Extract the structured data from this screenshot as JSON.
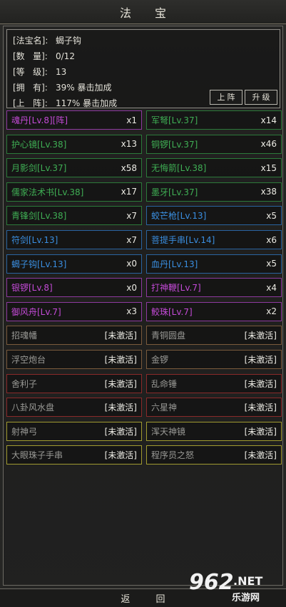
{
  "title": "法 宝",
  "info": {
    "rows": [
      {
        "key": "[法宝名]:",
        "value": "蝎子钩"
      },
      {
        "key": "[数   量]:",
        "value": "0/12"
      },
      {
        "key": "[等   级]:",
        "value": "13"
      },
      {
        "key": "[拥   有]:",
        "value": "39% 暴击加成"
      },
      {
        "key": "[上   阵]:",
        "value": "117% 暴击加成"
      }
    ],
    "btn_equip": "上阵",
    "btn_upgrade": "升级"
  },
  "items": [
    {
      "name": "魂丹[Lv.8][阵]",
      "count": "x1",
      "color": "#c34ad6",
      "border": "#8e3aa0"
    },
    {
      "name": "军弩[Lv.37]",
      "count": "x14",
      "color": "#3fae54",
      "border": "#2c7a3a"
    },
    {
      "name": "护心镜[Lv.38]",
      "count": "x13",
      "color": "#3fae54",
      "border": "#2c7a3a"
    },
    {
      "name": "铜锣[Lv.37]",
      "count": "x46",
      "color": "#3fae54",
      "border": "#2c7a3a"
    },
    {
      "name": "月影剑[Lv.37]",
      "count": "x58",
      "color": "#3fae54",
      "border": "#2c7a3a"
    },
    {
      "name": "无悔箭[Lv.38]",
      "count": "x15",
      "color": "#3fae54",
      "border": "#2c7a3a"
    },
    {
      "name": "儒家法术书[Lv.38]",
      "count": "x17",
      "color": "#3fae54",
      "border": "#2c7a3a"
    },
    {
      "name": "墨牙[Lv.37]",
      "count": "x38",
      "color": "#3fae54",
      "border": "#2c7a3a"
    },
    {
      "name": "青锋剑[Lv.38]",
      "count": "x7",
      "color": "#3fae54",
      "border": "#2c7a3a"
    },
    {
      "name": "蛟芒枪[Lv.13]",
      "count": "x5",
      "color": "#3a8ee0",
      "border": "#2a64a0"
    },
    {
      "name": "符剑[Lv.13]",
      "count": "x7",
      "color": "#3a8ee0",
      "border": "#2a64a0"
    },
    {
      "name": "菩提手串[Lv.14]",
      "count": "x6",
      "color": "#3a8ee0",
      "border": "#2a64a0"
    },
    {
      "name": "蝎子钩[Lv.13]",
      "count": "x0",
      "color": "#3a8ee0",
      "border": "#2a64a0"
    },
    {
      "name": "血丹[Lv.13]",
      "count": "x5",
      "color": "#3a8ee0",
      "border": "#2a64a0"
    },
    {
      "name": "银锣[Lv.8]",
      "count": "x0",
      "color": "#c34ad6",
      "border": "#8e3aa0"
    },
    {
      "name": "打神鞭[Lv.7]",
      "count": "x4",
      "color": "#c34ad6",
      "border": "#8e3aa0"
    },
    {
      "name": "御风舟[Lv.7]",
      "count": "x3",
      "color": "#c34ad6",
      "border": "#8e3aa0"
    },
    {
      "name": "鲛珠[Lv.7]",
      "count": "x2",
      "color": "#c34ad6",
      "border": "#8e3aa0"
    },
    {
      "name": "招魂幡",
      "count": "[未激活]",
      "color": "#9a9a96",
      "border": "#7a5a3c"
    },
    {
      "name": "青铜圆盘",
      "count": "[未激活]",
      "color": "#9a9a96",
      "border": "#7a5a3c"
    },
    {
      "name": "浮空炮台",
      "count": "[未激活]",
      "color": "#9a9a96",
      "border": "#7a5a3c"
    },
    {
      "name": "金锣",
      "count": "[未激活]",
      "color": "#9a9a96",
      "border": "#7a5a3c"
    },
    {
      "name": "舍利子",
      "count": "[未激活]",
      "color": "#9a9a96",
      "border": "#8a2a2a"
    },
    {
      "name": "乱命锤",
      "count": "[未激活]",
      "color": "#9a9a96",
      "border": "#8a2a2a"
    },
    {
      "name": "八卦风水盘",
      "count": "[未激活]",
      "color": "#9a9a96",
      "border": "#8a2a2a"
    },
    {
      "name": "六星神",
      "count": "[未激活]",
      "color": "#9a9a96",
      "border": "#8a2a2a"
    },
    {
      "name": "射神弓",
      "count": "[未激活]",
      "color": "#9a9a96",
      "border": "#a09a30"
    },
    {
      "name": "浑天神镜",
      "count": "[未激活]",
      "color": "#9a9a96",
      "border": "#a09a30"
    },
    {
      "name": "大眼珠子手串",
      "count": "[未激活]",
      "color": "#9a9a96",
      "border": "#a09a30"
    },
    {
      "name": "程序员之怒",
      "count": "[未激活]",
      "color": "#9a9a96",
      "border": "#a09a30"
    }
  ],
  "footer": "返 回",
  "watermark": {
    "num": "962",
    "net": ".NET",
    "cn": "乐游网"
  }
}
